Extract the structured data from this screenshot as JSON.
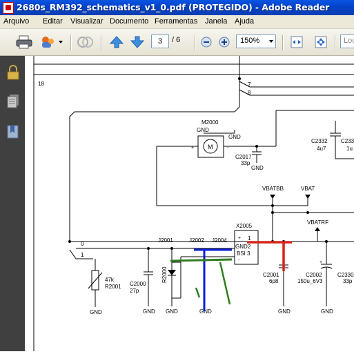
{
  "window": {
    "title": "2680s_RM392_schematics_v1_0.pdf (PROTEGIDO) - Adobe Reader"
  },
  "menu": [
    "Arquivo",
    "Editar",
    "Visualizar",
    "Documento",
    "Ferramentas",
    "Janela",
    "Ajuda"
  ],
  "toolbar": {
    "current_page": "3",
    "page_separator": "/",
    "total_pages": "6",
    "zoom": "150%",
    "search_placeholder": "Loc"
  },
  "navpane": {
    "icons": [
      "lock-icon",
      "pages-icon",
      "bookmarks-icon"
    ]
  },
  "schematic": {
    "labels": {
      "n18": "18",
      "n7": "7",
      "n8": "8",
      "m2000": "M2000",
      "gnd_m1": "GND",
      "gnd_m2": "GND",
      "motor": "M",
      "plus_left": "+",
      "minus_right": "-",
      "c2017": "C2017",
      "c2017_val": "33p",
      "gnd_c2017": "GND",
      "c2332": "C2332",
      "c2332_val": "4u7",
      "c233x": "C233",
      "c233x_val": "1u",
      "vbatbb": "VBATBB",
      "vbat": "VBAT",
      "vbatrf": "VBATRF",
      "x2005": "X2005",
      "x_pin1": "1",
      "x_pin2": "2",
      "x_pin3": "3",
      "x_gnd": "GND",
      "x_bsi": "BSI",
      "x_plus": "+",
      "x_minus": "-",
      "n0": "0",
      "n1": "1",
      "j2001": "J2001",
      "j2002": "J2002",
      "j2004": "J2004",
      "r2001_val": "47k",
      "r2001": "R2001",
      "c2000": "C2000",
      "c2000_val": "27p",
      "r2000": "R2000",
      "c2001": "C2001",
      "c2001_val": "6p8",
      "c2002": "C2002",
      "c2002_val": "150u_6V3",
      "c2330": "C2330",
      "c2330_val": "33p",
      "c2002_plus": "+",
      "gnd1": "GND",
      "gnd2": "GND",
      "gnd3": "GND",
      "gnd4": "GND",
      "gnd5": "GND",
      "gnd6": "GND"
    }
  },
  "colors": {
    "titlebar": "#0442c6",
    "annotation_blue": "#0a1fd6",
    "annotation_green": "#2e7d1e",
    "annotation_red": "#d8231a",
    "navpane": "#404040"
  }
}
